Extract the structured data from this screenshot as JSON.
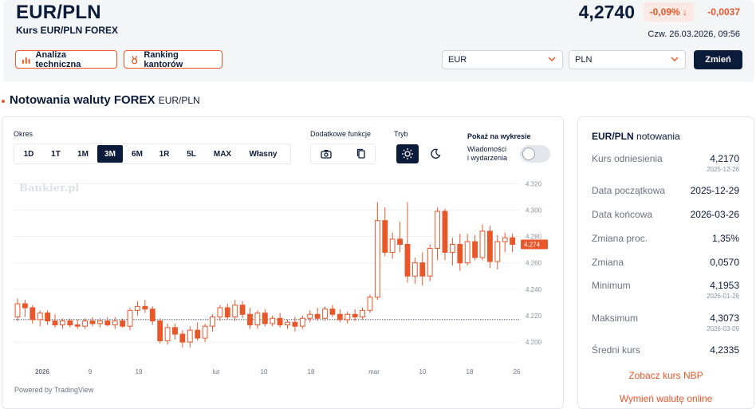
{
  "header": {
    "title": "EUR/PLN",
    "subtitle": "Kurs EUR/PLN FOREX",
    "price": "4,2740",
    "change_pct": "-0,09% ↓",
    "change_abs": "-0,0037",
    "timestamp": "Czw. 26.03.2026, 09:56",
    "tech_button": "Analiza techniczna",
    "ranking_button": "Ranking kantorów",
    "from_currency": "EUR",
    "to_currency": "PLN",
    "change_button": "Zmień",
    "colors": {
      "accent": "#e8572a",
      "navy": "#0b1b3a",
      "down_bg": "#fde9e3"
    }
  },
  "section": {
    "title": "Notowania waluty FOREX",
    "pair": "EUR/PLN"
  },
  "controls": {
    "period_label": "Okres",
    "periods": [
      "1D",
      "1T",
      "1M",
      "3M",
      "6M",
      "1R",
      "5L",
      "MAX",
      "Własny"
    ],
    "active_period": "3M",
    "extra_label": "Dodatkowe funkcje",
    "mode_label": "Tryb",
    "show_label": "Pokaż na wykresie",
    "news_line1": "Wiadomości",
    "news_line2": "i wydarzenia",
    "news_toggle_on": false,
    "icons": [
      "camera-icon",
      "copy-icon",
      "sun-icon",
      "moon-icon"
    ]
  },
  "chart_data": {
    "type": "candlestick",
    "watermark": "Bankier.pl",
    "powered_by": "Powered by TradingView",
    "ylim": [
      4.194,
      4.322
    ],
    "y_ticks": [
      "4.320",
      "4.300",
      "4.280",
      "4.260",
      "4.240",
      "4.220",
      "4.200"
    ],
    "x_ticks": [
      "2026",
      "9",
      "19",
      "lut",
      "10",
      "18",
      "mar",
      "10",
      "18",
      "26"
    ],
    "last_price_label": "4.274",
    "reference_line": 4.217,
    "up_color": "#e8572a",
    "down_color": "#e8572a",
    "candles": [
      {
        "o": 4.219,
        "h": 4.233,
        "l": 4.216,
        "c": 4.229
      },
      {
        "o": 4.229,
        "h": 4.232,
        "l": 4.219,
        "c": 4.226
      },
      {
        "o": 4.226,
        "h": 4.228,
        "l": 4.214,
        "c": 4.217
      },
      {
        "o": 4.217,
        "h": 4.224,
        "l": 4.212,
        "c": 4.222
      },
      {
        "o": 4.222,
        "h": 4.224,
        "l": 4.213,
        "c": 4.216
      },
      {
        "o": 4.216,
        "h": 4.221,
        "l": 4.211,
        "c": 4.213
      },
      {
        "o": 4.213,
        "h": 4.218,
        "l": 4.21,
        "c": 4.216
      },
      {
        "o": 4.216,
        "h": 4.218,
        "l": 4.211,
        "c": 4.213
      },
      {
        "o": 4.213,
        "h": 4.217,
        "l": 4.21,
        "c": 4.212
      },
      {
        "o": 4.212,
        "h": 4.218,
        "l": 4.21,
        "c": 4.216
      },
      {
        "o": 4.216,
        "h": 4.219,
        "l": 4.212,
        "c": 4.214
      },
      {
        "o": 4.214,
        "h": 4.218,
        "l": 4.211,
        "c": 4.216
      },
      {
        "o": 4.216,
        "h": 4.219,
        "l": 4.212,
        "c": 4.213
      },
      {
        "o": 4.213,
        "h": 4.219,
        "l": 4.21,
        "c": 4.216
      },
      {
        "o": 4.216,
        "h": 4.218,
        "l": 4.211,
        "c": 4.212
      },
      {
        "o": 4.212,
        "h": 4.226,
        "l": 4.209,
        "c": 4.224
      },
      {
        "o": 4.224,
        "h": 4.231,
        "l": 4.22,
        "c": 4.227
      },
      {
        "o": 4.227,
        "h": 4.232,
        "l": 4.222,
        "c": 4.225
      },
      {
        "o": 4.225,
        "h": 4.227,
        "l": 4.213,
        "c": 4.216
      },
      {
        "o": 4.216,
        "h": 4.218,
        "l": 4.199,
        "c": 4.201
      },
      {
        "o": 4.201,
        "h": 4.214,
        "l": 4.198,
        "c": 4.211
      },
      {
        "o": 4.211,
        "h": 4.214,
        "l": 4.202,
        "c": 4.206
      },
      {
        "o": 4.206,
        "h": 4.209,
        "l": 4.196,
        "c": 4.2
      },
      {
        "o": 4.2,
        "h": 4.212,
        "l": 4.196,
        "c": 4.209
      },
      {
        "o": 4.209,
        "h": 4.215,
        "l": 4.201,
        "c": 4.203
      },
      {
        "o": 4.203,
        "h": 4.214,
        "l": 4.2,
        "c": 4.212
      },
      {
        "o": 4.212,
        "h": 4.221,
        "l": 4.208,
        "c": 4.219
      },
      {
        "o": 4.219,
        "h": 4.228,
        "l": 4.216,
        "c": 4.226
      },
      {
        "o": 4.226,
        "h": 4.229,
        "l": 4.217,
        "c": 4.219
      },
      {
        "o": 4.219,
        "h": 4.232,
        "l": 4.216,
        "c": 4.228
      },
      {
        "o": 4.228,
        "h": 4.231,
        "l": 4.218,
        "c": 4.221
      },
      {
        "o": 4.221,
        "h": 4.226,
        "l": 4.21,
        "c": 4.213
      },
      {
        "o": 4.213,
        "h": 4.224,
        "l": 4.21,
        "c": 4.222
      },
      {
        "o": 4.222,
        "h": 4.225,
        "l": 4.212,
        "c": 4.214
      },
      {
        "o": 4.214,
        "h": 4.22,
        "l": 4.212,
        "c": 4.218
      },
      {
        "o": 4.218,
        "h": 4.222,
        "l": 4.211,
        "c": 4.213
      },
      {
        "o": 4.213,
        "h": 4.217,
        "l": 4.21,
        "c": 4.215
      },
      {
        "o": 4.215,
        "h": 4.219,
        "l": 4.208,
        "c": 4.212
      },
      {
        "o": 4.212,
        "h": 4.22,
        "l": 4.21,
        "c": 4.218
      },
      {
        "o": 4.218,
        "h": 4.224,
        "l": 4.215,
        "c": 4.221
      },
      {
        "o": 4.221,
        "h": 4.226,
        "l": 4.216,
        "c": 4.218
      },
      {
        "o": 4.218,
        "h": 4.227,
        "l": 4.216,
        "c": 4.225
      },
      {
        "o": 4.225,
        "h": 4.228,
        "l": 4.219,
        "c": 4.221
      },
      {
        "o": 4.221,
        "h": 4.225,
        "l": 4.215,
        "c": 4.217
      },
      {
        "o": 4.217,
        "h": 4.223,
        "l": 4.214,
        "c": 4.221
      },
      {
        "o": 4.221,
        "h": 4.225,
        "l": 4.216,
        "c": 4.219
      },
      {
        "o": 4.219,
        "h": 4.226,
        "l": 4.217,
        "c": 4.224
      },
      {
        "o": 4.224,
        "h": 4.236,
        "l": 4.222,
        "c": 4.234
      },
      {
        "o": 4.234,
        "h": 4.306,
        "l": 4.232,
        "c": 4.292
      },
      {
        "o": 4.292,
        "h": 4.302,
        "l": 4.265,
        "c": 4.268
      },
      {
        "o": 4.268,
        "h": 4.283,
        "l": 4.263,
        "c": 4.278
      },
      {
        "o": 4.278,
        "h": 4.291,
        "l": 4.268,
        "c": 4.274
      },
      {
        "o": 4.274,
        "h": 4.306,
        "l": 4.245,
        "c": 4.25
      },
      {
        "o": 4.25,
        "h": 4.264,
        "l": 4.244,
        "c": 4.26
      },
      {
        "o": 4.26,
        "h": 4.268,
        "l": 4.243,
        "c": 4.25
      },
      {
        "o": 4.25,
        "h": 4.274,
        "l": 4.246,
        "c": 4.271
      },
      {
        "o": 4.271,
        "h": 4.302,
        "l": 4.262,
        "c": 4.299
      },
      {
        "o": 4.299,
        "h": 4.301,
        "l": 4.262,
        "c": 4.268
      },
      {
        "o": 4.268,
        "h": 4.279,
        "l": 4.258,
        "c": 4.274
      },
      {
        "o": 4.274,
        "h": 4.282,
        "l": 4.254,
        "c": 4.26
      },
      {
        "o": 4.26,
        "h": 4.282,
        "l": 4.258,
        "c": 4.276
      },
      {
        "o": 4.276,
        "h": 4.281,
        "l": 4.262,
        "c": 4.264
      },
      {
        "o": 4.264,
        "h": 4.289,
        "l": 4.262,
        "c": 4.284
      },
      {
        "o": 4.284,
        "h": 4.288,
        "l": 4.256,
        "c": 4.261
      },
      {
        "o": 4.261,
        "h": 4.281,
        "l": 4.255,
        "c": 4.276
      },
      {
        "o": 4.276,
        "h": 4.283,
        "l": 4.268,
        "c": 4.279
      },
      {
        "o": 4.279,
        "h": 4.282,
        "l": 4.268,
        "c": 4.274
      }
    ]
  },
  "stats": {
    "title_pair": "EUR/PLN",
    "title_suffix": "notowania",
    "rows": [
      {
        "label": "Kurs odniesienia",
        "value": "4,2170",
        "date": "2025-12-26"
      },
      {
        "label": "Data początkowa",
        "value": "2025-12-29",
        "date": ""
      },
      {
        "label": "Data końcowa",
        "value": "2026-03-26",
        "date": ""
      },
      {
        "label": "Zmiana proc.",
        "value": "1,35%",
        "date": ""
      },
      {
        "label": "Zmiana",
        "value": "0,0570",
        "date": ""
      },
      {
        "label": "Minimum",
        "value": "4,1953",
        "date": "2026-01-28"
      },
      {
        "label": "Maksimum",
        "value": "4,3073",
        "date": "2026-03-09"
      },
      {
        "label": "Średni kurs",
        "value": "4,2335",
        "date": ""
      }
    ],
    "link_nbp": "Zobacz kurs NBP",
    "link_exchange": "Wymień walutę online"
  }
}
